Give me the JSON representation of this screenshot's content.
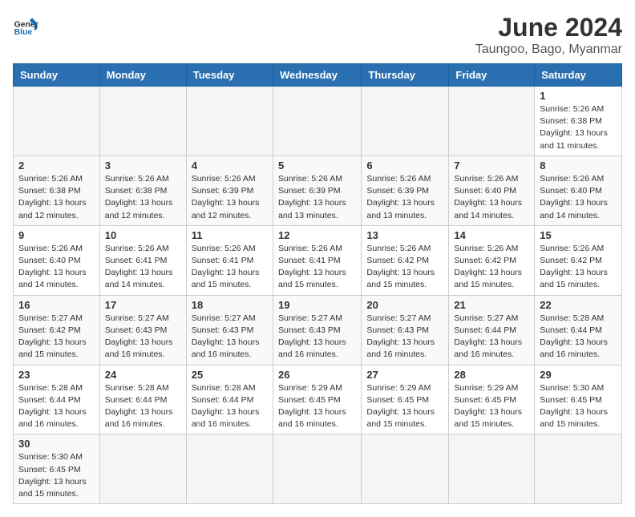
{
  "header": {
    "logo_general": "General",
    "logo_blue": "Blue",
    "month": "June 2024",
    "location": "Taungoo, Bago, Myanmar"
  },
  "weekdays": [
    "Sunday",
    "Monday",
    "Tuesday",
    "Wednesday",
    "Thursday",
    "Friday",
    "Saturday"
  ],
  "weeks": [
    [
      {
        "day": "",
        "info": ""
      },
      {
        "day": "",
        "info": ""
      },
      {
        "day": "",
        "info": ""
      },
      {
        "day": "",
        "info": ""
      },
      {
        "day": "",
        "info": ""
      },
      {
        "day": "",
        "info": ""
      },
      {
        "day": "1",
        "info": "Sunrise: 5:26 AM\nSunset: 6:38 PM\nDaylight: 13 hours and 11 minutes."
      }
    ],
    [
      {
        "day": "2",
        "info": "Sunrise: 5:26 AM\nSunset: 6:38 PM\nDaylight: 13 hours and 12 minutes."
      },
      {
        "day": "3",
        "info": "Sunrise: 5:26 AM\nSunset: 6:38 PM\nDaylight: 13 hours and 12 minutes."
      },
      {
        "day": "4",
        "info": "Sunrise: 5:26 AM\nSunset: 6:39 PM\nDaylight: 13 hours and 12 minutes."
      },
      {
        "day": "5",
        "info": "Sunrise: 5:26 AM\nSunset: 6:39 PM\nDaylight: 13 hours and 13 minutes."
      },
      {
        "day": "6",
        "info": "Sunrise: 5:26 AM\nSunset: 6:39 PM\nDaylight: 13 hours and 13 minutes."
      },
      {
        "day": "7",
        "info": "Sunrise: 5:26 AM\nSunset: 6:40 PM\nDaylight: 13 hours and 14 minutes."
      },
      {
        "day": "8",
        "info": "Sunrise: 5:26 AM\nSunset: 6:40 PM\nDaylight: 13 hours and 14 minutes."
      }
    ],
    [
      {
        "day": "9",
        "info": "Sunrise: 5:26 AM\nSunset: 6:40 PM\nDaylight: 13 hours and 14 minutes."
      },
      {
        "day": "10",
        "info": "Sunrise: 5:26 AM\nSunset: 6:41 PM\nDaylight: 13 hours and 14 minutes."
      },
      {
        "day": "11",
        "info": "Sunrise: 5:26 AM\nSunset: 6:41 PM\nDaylight: 13 hours and 15 minutes."
      },
      {
        "day": "12",
        "info": "Sunrise: 5:26 AM\nSunset: 6:41 PM\nDaylight: 13 hours and 15 minutes."
      },
      {
        "day": "13",
        "info": "Sunrise: 5:26 AM\nSunset: 6:42 PM\nDaylight: 13 hours and 15 minutes."
      },
      {
        "day": "14",
        "info": "Sunrise: 5:26 AM\nSunset: 6:42 PM\nDaylight: 13 hours and 15 minutes."
      },
      {
        "day": "15",
        "info": "Sunrise: 5:26 AM\nSunset: 6:42 PM\nDaylight: 13 hours and 15 minutes."
      }
    ],
    [
      {
        "day": "16",
        "info": "Sunrise: 5:27 AM\nSunset: 6:42 PM\nDaylight: 13 hours and 15 minutes."
      },
      {
        "day": "17",
        "info": "Sunrise: 5:27 AM\nSunset: 6:43 PM\nDaylight: 13 hours and 16 minutes."
      },
      {
        "day": "18",
        "info": "Sunrise: 5:27 AM\nSunset: 6:43 PM\nDaylight: 13 hours and 16 minutes."
      },
      {
        "day": "19",
        "info": "Sunrise: 5:27 AM\nSunset: 6:43 PM\nDaylight: 13 hours and 16 minutes."
      },
      {
        "day": "20",
        "info": "Sunrise: 5:27 AM\nSunset: 6:43 PM\nDaylight: 13 hours and 16 minutes."
      },
      {
        "day": "21",
        "info": "Sunrise: 5:27 AM\nSunset: 6:44 PM\nDaylight: 13 hours and 16 minutes."
      },
      {
        "day": "22",
        "info": "Sunrise: 5:28 AM\nSunset: 6:44 PM\nDaylight: 13 hours and 16 minutes."
      }
    ],
    [
      {
        "day": "23",
        "info": "Sunrise: 5:28 AM\nSunset: 6:44 PM\nDaylight: 13 hours and 16 minutes."
      },
      {
        "day": "24",
        "info": "Sunrise: 5:28 AM\nSunset: 6:44 PM\nDaylight: 13 hours and 16 minutes."
      },
      {
        "day": "25",
        "info": "Sunrise: 5:28 AM\nSunset: 6:44 PM\nDaylight: 13 hours and 16 minutes."
      },
      {
        "day": "26",
        "info": "Sunrise: 5:29 AM\nSunset: 6:45 PM\nDaylight: 13 hours and 16 minutes."
      },
      {
        "day": "27",
        "info": "Sunrise: 5:29 AM\nSunset: 6:45 PM\nDaylight: 13 hours and 15 minutes."
      },
      {
        "day": "28",
        "info": "Sunrise: 5:29 AM\nSunset: 6:45 PM\nDaylight: 13 hours and 15 minutes."
      },
      {
        "day": "29",
        "info": "Sunrise: 5:30 AM\nSunset: 6:45 PM\nDaylight: 13 hours and 15 minutes."
      }
    ],
    [
      {
        "day": "30",
        "info": "Sunrise: 5:30 AM\nSunset: 6:45 PM\nDaylight: 13 hours and 15 minutes."
      },
      {
        "day": "",
        "info": ""
      },
      {
        "day": "",
        "info": ""
      },
      {
        "day": "",
        "info": ""
      },
      {
        "day": "",
        "info": ""
      },
      {
        "day": "",
        "info": ""
      },
      {
        "day": "",
        "info": ""
      }
    ]
  ]
}
